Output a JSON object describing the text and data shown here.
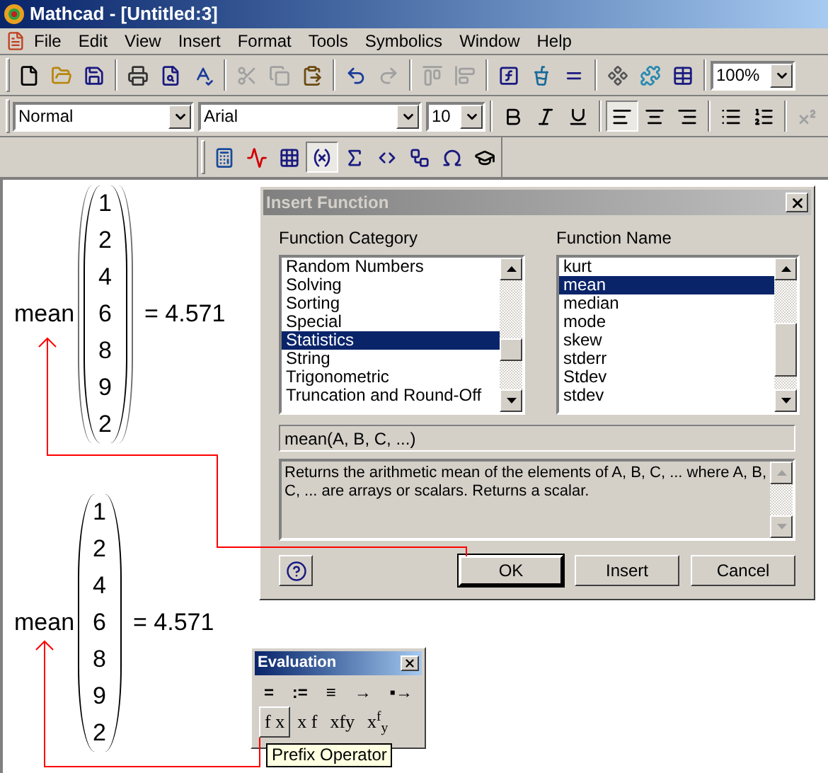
{
  "window": {
    "title": "Mathcad - [Untitled:3]"
  },
  "menu": [
    "File",
    "Edit",
    "View",
    "Insert",
    "Format",
    "Tools",
    "Symbolics",
    "Window",
    "Help"
  ],
  "toolbars": {
    "standard": [
      {
        "disabled": false
      },
      {
        "disabled": false
      },
      {
        "disabled": false
      },
      {
        "disabled": false
      },
      {
        "disabled": false
      },
      {
        "disabled": false
      },
      {
        "disabled": true
      },
      {
        "disabled": true
      },
      {
        "disabled": false
      },
      {
        "disabled": false
      },
      {
        "disabled": true
      },
      {
        "disabled": true
      },
      {
        "disabled": true
      },
      {
        "disabled": false
      },
      {
        "disabled": false
      },
      {
        "disabled": false
      },
      {
        "disabled": false
      },
      {
        "disabled": false
      },
      {
        "disabled": false
      }
    ],
    "zoom": "100%",
    "style": "Normal",
    "font": "Arial",
    "size": "10",
    "formatting": [
      {
        "on": false,
        "disabled": false
      },
      {
        "on": false,
        "disabled": false
      },
      {
        "on": false,
        "disabled": false
      },
      {
        "on": true,
        "disabled": false
      },
      {
        "on": false,
        "disabled": false
      },
      {
        "on": false,
        "disabled": false
      },
      {
        "on": false,
        "disabled": false
      },
      {
        "on": false,
        "disabled": false
      },
      {
        "on": false,
        "disabled": true
      }
    ],
    "math": [
      {
        "on": false
      },
      {
        "on": false
      },
      {
        "on": false
      },
      {
        "on": true
      },
      {
        "on": false
      },
      {
        "on": false
      },
      {
        "on": false
      },
      {
        "on": false
      },
      {
        "on": false
      }
    ]
  },
  "worksheet": {
    "expressions": [
      {
        "function": "mean",
        "nested": true,
        "values": [
          "1",
          "2",
          "4",
          "6",
          "8",
          "9",
          "2"
        ],
        "result": "= 4.571"
      },
      {
        "function": "mean",
        "nested": false,
        "values": [
          "1",
          "2",
          "4",
          "6",
          "8",
          "9",
          "2"
        ],
        "result": "= 4.571"
      }
    ]
  },
  "insert_function": {
    "title": "Insert Function",
    "category_label": "Function Category",
    "categories": [
      {
        "label": "Random Numbers",
        "selected": false
      },
      {
        "label": "Solving",
        "selected": false
      },
      {
        "label": "Sorting",
        "selected": false
      },
      {
        "label": "Special",
        "selected": false
      },
      {
        "label": "Statistics",
        "selected": true
      },
      {
        "label": "String",
        "selected": false
      },
      {
        "label": "Trigonometric",
        "selected": false
      },
      {
        "label": "Truncation and Round-Off",
        "selected": false
      }
    ],
    "name_label": "Function Name",
    "names": [
      {
        "label": "kurt",
        "selected": false
      },
      {
        "label": "mean",
        "selected": true
      },
      {
        "label": "median",
        "selected": false
      },
      {
        "label": "mode",
        "selected": false
      },
      {
        "label": "skew",
        "selected": false
      },
      {
        "label": "stderr",
        "selected": false
      },
      {
        "label": "Stdev",
        "selected": false
      },
      {
        "label": "stdev",
        "selected": false
      }
    ],
    "signature": "mean(A, B, C, ...)",
    "description": "Returns the arithmetic mean of the elements of A, B, C, ... where A, B, C, ... are arrays or scalars. Returns a scalar.",
    "buttons": [
      {
        "label": "OK",
        "default": true
      },
      {
        "label": "Insert",
        "default": false
      },
      {
        "label": "Cancel",
        "default": false
      }
    ]
  },
  "evaluation_palette": {
    "title": "Evaluation",
    "operators": [
      {
        "label": "=",
        "selected": false
      },
      {
        "label": ":=",
        "selected": false
      },
      {
        "label": "≡",
        "selected": false
      },
      {
        "label": "→",
        "selected": false
      },
      {
        "label": "▪→",
        "selected": false
      }
    ],
    "styles": [
      {
        "label": "f x",
        "selected": true
      },
      {
        "label": "x f",
        "selected": false
      },
      {
        "label": "xfy",
        "selected": false
      },
      {
        "label": "x$^{f}$$_{y}$",
        "selected": false
      }
    ],
    "tooltip": "Prefix Operator"
  }
}
